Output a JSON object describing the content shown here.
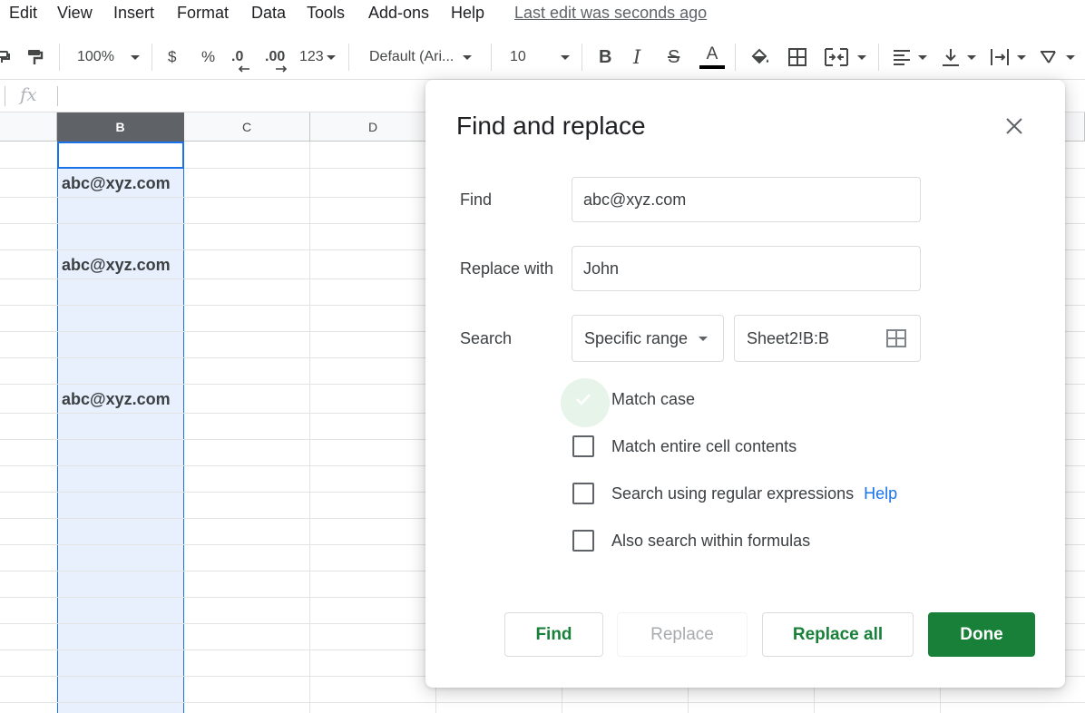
{
  "menu": {
    "items": [
      "Edit",
      "View",
      "Insert",
      "Format",
      "Data",
      "Tools",
      "Add-ons",
      "Help"
    ],
    "last_edit": "Last edit was seconds ago"
  },
  "toolbar": {
    "zoom": "100%",
    "currency": "$",
    "percent": "%",
    "decrease_decimal": ".0",
    "increase_decimal": ".00",
    "more_formats": "123",
    "font": "Default (Ari...",
    "font_size": "10",
    "bold": "B",
    "italic": "I",
    "strikethrough": "S",
    "text_color": "A",
    "icons": [
      "paint-roller-icon",
      "paint-format-icon",
      "fill-color-icon",
      "borders-icon",
      "merge-cells-icon",
      "align-left-icon",
      "vertical-align-icon",
      "text-wrap-icon",
      "text-rotation-icon"
    ]
  },
  "formula_bar": {
    "fx": "fx"
  },
  "grid": {
    "columns": [
      {
        "label": "B",
        "selected": true
      },
      {
        "label": "C",
        "selected": false
      },
      {
        "label": "D",
        "selected": false
      }
    ],
    "cells": [
      "abc@xyz.com",
      "abc@xyz.com",
      "abc@xyz.com"
    ]
  },
  "dialog": {
    "title": "Find and replace",
    "find": {
      "label": "Find",
      "value": "abc@xyz.com"
    },
    "replace": {
      "label": "Replace with",
      "value": "John"
    },
    "search": {
      "label": "Search",
      "scope": "Specific range",
      "range": "Sheet2!B:B"
    },
    "options": [
      {
        "label": "Match case",
        "checked": true
      },
      {
        "label": "Match entire cell contents",
        "checked": false
      },
      {
        "label": "Search using regular expressions",
        "checked": false,
        "link": "Help"
      },
      {
        "label": "Also search within formulas",
        "checked": false
      }
    ],
    "buttons": {
      "find": "Find",
      "replace": "Replace",
      "replace_all": "Replace all",
      "done": "Done"
    }
  },
  "colors": {
    "accent_green": "#188038",
    "selection_blue": "#1a73e8",
    "selection_fill": "#e8f0fe",
    "link_blue": "#1a73e8"
  }
}
